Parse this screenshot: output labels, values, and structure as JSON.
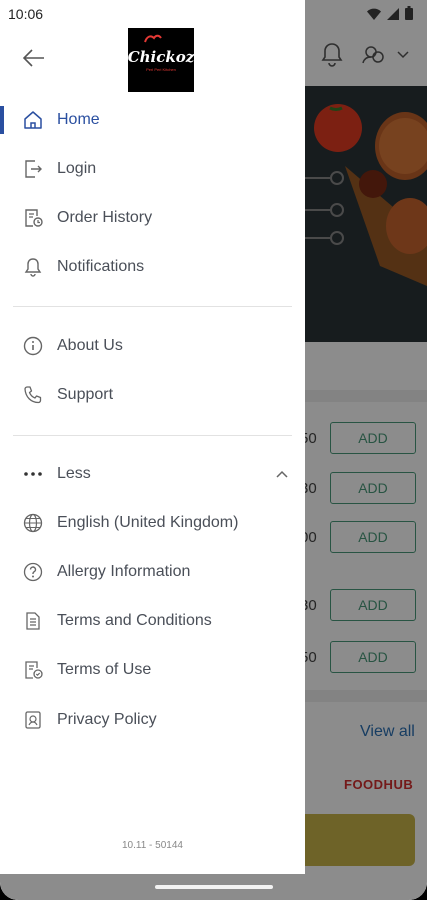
{
  "status_bar": {
    "time": "10:06"
  },
  "drawer": {
    "logo": {
      "name": "Chickoz",
      "tagline": "Peri Peri Kitchen"
    },
    "primary_items": [
      {
        "label": "Home",
        "icon": "home-icon",
        "active": true
      },
      {
        "label": "Login",
        "icon": "login-icon"
      },
      {
        "label": "Order History",
        "icon": "order-history-icon"
      },
      {
        "label": "Notifications",
        "icon": "bell-icon"
      }
    ],
    "secondary_items": [
      {
        "label": "About Us",
        "icon": "info-icon"
      },
      {
        "label": "Support",
        "icon": "phone-icon"
      }
    ],
    "more_section": {
      "label": "Less",
      "icon": "more-dots-icon"
    },
    "tertiary_items": [
      {
        "label": "English (United Kingdom)",
        "icon": "globe-icon"
      },
      {
        "label": "Allergy Information",
        "icon": "question-icon"
      },
      {
        "label": "Terms and Conditions",
        "icon": "document-icon"
      },
      {
        "label": "Terms of Use",
        "icon": "document-check-icon"
      },
      {
        "label": "Privacy Policy",
        "icon": "privacy-icon"
      }
    ],
    "version": "10.11 - 50144"
  },
  "background": {
    "rows": [
      {
        "price": "50",
        "add_label": "ADD"
      },
      {
        "price": "30",
        "add_label": "ADD"
      },
      {
        "price": "00",
        "add_label": "ADD"
      },
      {
        "price": "30",
        "add_label": "ADD"
      },
      {
        "price": "50",
        "add_label": "ADD"
      }
    ],
    "view_all": "View all",
    "brand": "FOODHUB"
  },
  "colors": {
    "accent": "#2a4fa0",
    "add_button": "#4a9a7a",
    "brand_red": "#d32f2f"
  }
}
